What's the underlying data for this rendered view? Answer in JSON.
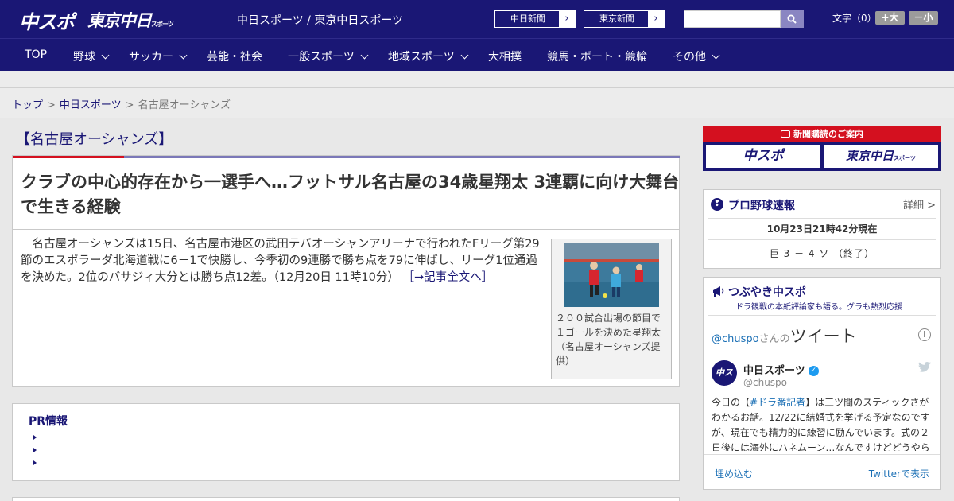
{
  "header": {
    "logo_chuspo": "中スポ",
    "logo_tokyo": "東京中日",
    "logo_tokyo_small": "スポーツ",
    "site_title": "中日スポーツ / 東京中日スポーツ",
    "btn_chunichi": "中日新聞",
    "btn_tokyo": "東京新聞",
    "arrow": "›",
    "search_placeholder": "",
    "font_size_label": "文字（0）",
    "font_larger": "+大",
    "font_smaller": "－小"
  },
  "nav": {
    "items": [
      "TOP",
      "野球",
      "サッカー",
      "芸能・社会",
      "一般スポーツ",
      "地域スポーツ",
      "大相撲",
      "競馬・ボート・競輪",
      "その他"
    ]
  },
  "breadcrumb": {
    "items": [
      "トップ",
      "中日スポーツ",
      "名古屋オーシャンズ"
    ],
    "separator": ">"
  },
  "article": {
    "category": "【名古屋オーシャンズ】",
    "headline": "クラブの中心的存在から一選手へ…フットサル名古屋の34歳星翔太 3連覇に向け大舞台で生きる経験",
    "body": "名古屋オーシャンズは15日、名古屋市港区の武田テバオーシャンアリーナで行われたFリーグ第29節のエスポラーダ北海道戦に6－1で快勝し、今季初の9連勝で勝ち点を79に伸ばし、リーグ1位通過を決めた。2位のバサジィ大分とは勝ち点12差。（12月20日 11時10分）",
    "read_more": "［→記事全文へ］",
    "photo_caption": "２００試合出場の節目で１ゴールを決めた星翔太（名古屋オーシャンズ提供）"
  },
  "pr": {
    "title": "PR情報"
  },
  "sidebar": {
    "subscribe_title": "新聞購読のご案内",
    "sub_logo_chuspo": "中スポ",
    "sub_logo_tokyo": "東京中日",
    "sub_logo_tokyo_small": "スポーツ",
    "baseball": {
      "title": "プロ野球速報",
      "detail": "詳細 >",
      "timestamp": "10月23日21時42分現在",
      "score": "巨 3 － 4 ソ （終了）"
    },
    "tweets": {
      "title": "つぶやき中スポ",
      "subtitle": "ドラ観戦の本紙評論家も語る。グラも熱烈応援",
      "handle": "@chuspo",
      "san": "さんの",
      "tweet_word": "ツイート",
      "info": "i",
      "avatar": "中スポ",
      "name": "中日スポーツ",
      "verified": "✓",
      "username": "@chuspo",
      "text_before": "今日の【",
      "text_tag": "#ドラ番記者",
      "text_after": "】は三ツ間のスティックさがわかるお話。12/22に結婚式を挙げる予定なのですが、現在でも精力的に練習に励んでいます。式の２日後には海外にハネムーン…なんですけどどうやら",
      "embed": "埋め込む",
      "view_on_twitter": "Twitterで表示"
    }
  },
  "colors": {
    "brand_navy": "#1a1775",
    "accent_red": "#d4101f",
    "accent_purple": "#7b78b8",
    "link_blue": "#1a6fb5"
  }
}
